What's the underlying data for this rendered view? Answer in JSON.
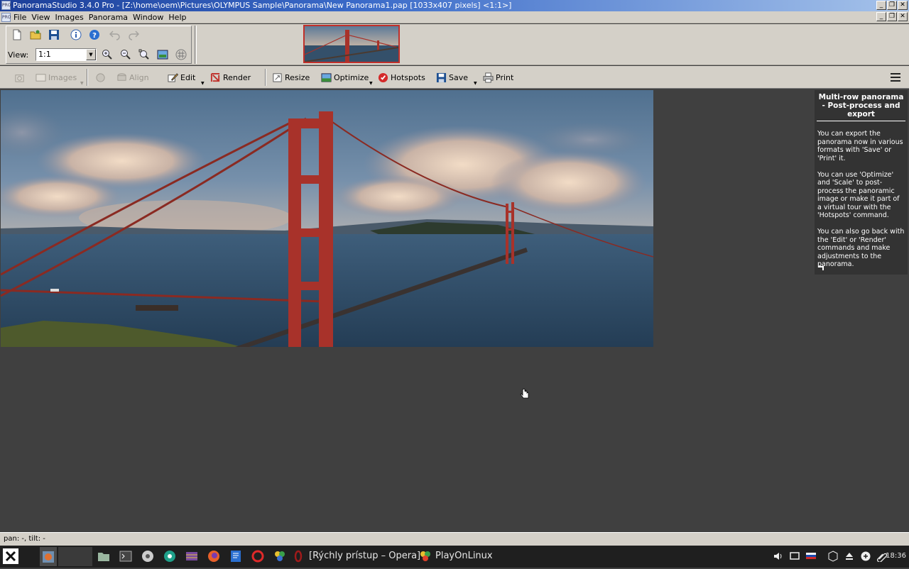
{
  "window": {
    "title": "PanoramaStudio 3.4.0 Pro - [Z:\\home\\oem\\Pictures\\OLYMPUS Sample\\Panorama\\New Panorama1.pap [1033x407 pixels] <1:1>]",
    "app_icon_text": "PRO"
  },
  "menu": {
    "items": [
      "File",
      "View",
      "Images",
      "Panorama",
      "Window",
      "Help"
    ]
  },
  "toolbar": {
    "view_label": "View:",
    "view_value": "1:1"
  },
  "toolbar2": {
    "images": "Images",
    "align": "Align",
    "edit": "Edit",
    "render": "Render",
    "resize": "Resize",
    "optimize": "Optimize",
    "hotspots": "Hotspots",
    "save": "Save",
    "print": "Print"
  },
  "help_panel": {
    "title": "Multi-row panorama - Post-process and export",
    "text": "You can export the panorama now in various formats with 'Save' or 'Print' it.\n\nYou can use 'Optimize' and 'Scale' to post-process the panoramic image or make it part of a virtual tour with the 'Hotspots' command.\n\nYou can also go back with the 'Edit' or 'Render' commands and make adjustments to the panorama."
  },
  "status": {
    "text": "pan: -, tilt: -"
  },
  "taskbar": {
    "opera_label": "[Rýchly prístup – Opera]",
    "playonlinux_label": "PlayOnLinux",
    "clock": "18:36"
  },
  "colors": {
    "titlebar_start": "#1c3f99",
    "workspace": "#404040",
    "help_panel": "#333333",
    "bridge_red": "#a8322a"
  }
}
